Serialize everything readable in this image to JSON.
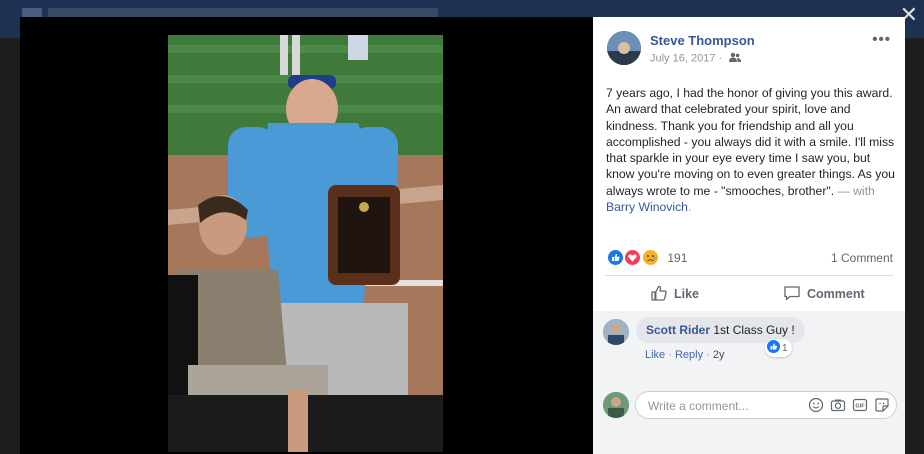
{
  "window": {
    "close_glyph": "✕"
  },
  "post": {
    "author": "Steve Thompson",
    "date": "July 16, 2017 ·",
    "audience_icon": "friends-icon",
    "more_glyph": "•••",
    "body": "7 years ago, I had the honor of giving you this award. An award that celebrated your spirit, love and kindness. Thank you for friendship and all you accomplished - you always did it with a smile. I'll miss that sparkle in your eye every time I saw you, but know you're moving on to even greater things. As you always wrote to me - \"smooches, brother\".",
    "with_prefix": " — with ",
    "tagged": "Barry Winovich",
    "tagged_suffix": "."
  },
  "reactions": {
    "types": [
      "like",
      "love",
      "sad"
    ],
    "count": "191",
    "comments_count": "1 Comment"
  },
  "actions": {
    "like": "Like",
    "comment": "Comment"
  },
  "comment": {
    "author": "Scott Rider",
    "text": "1st Class Guy !",
    "like": "Like",
    "reply": "Reply",
    "age": "2y",
    "like_count": "1"
  },
  "composer": {
    "placeholder": "Write a comment..."
  },
  "colors": {
    "link": "#365899",
    "viewer_bg": "#000000",
    "panel_bg": "#ffffff"
  }
}
